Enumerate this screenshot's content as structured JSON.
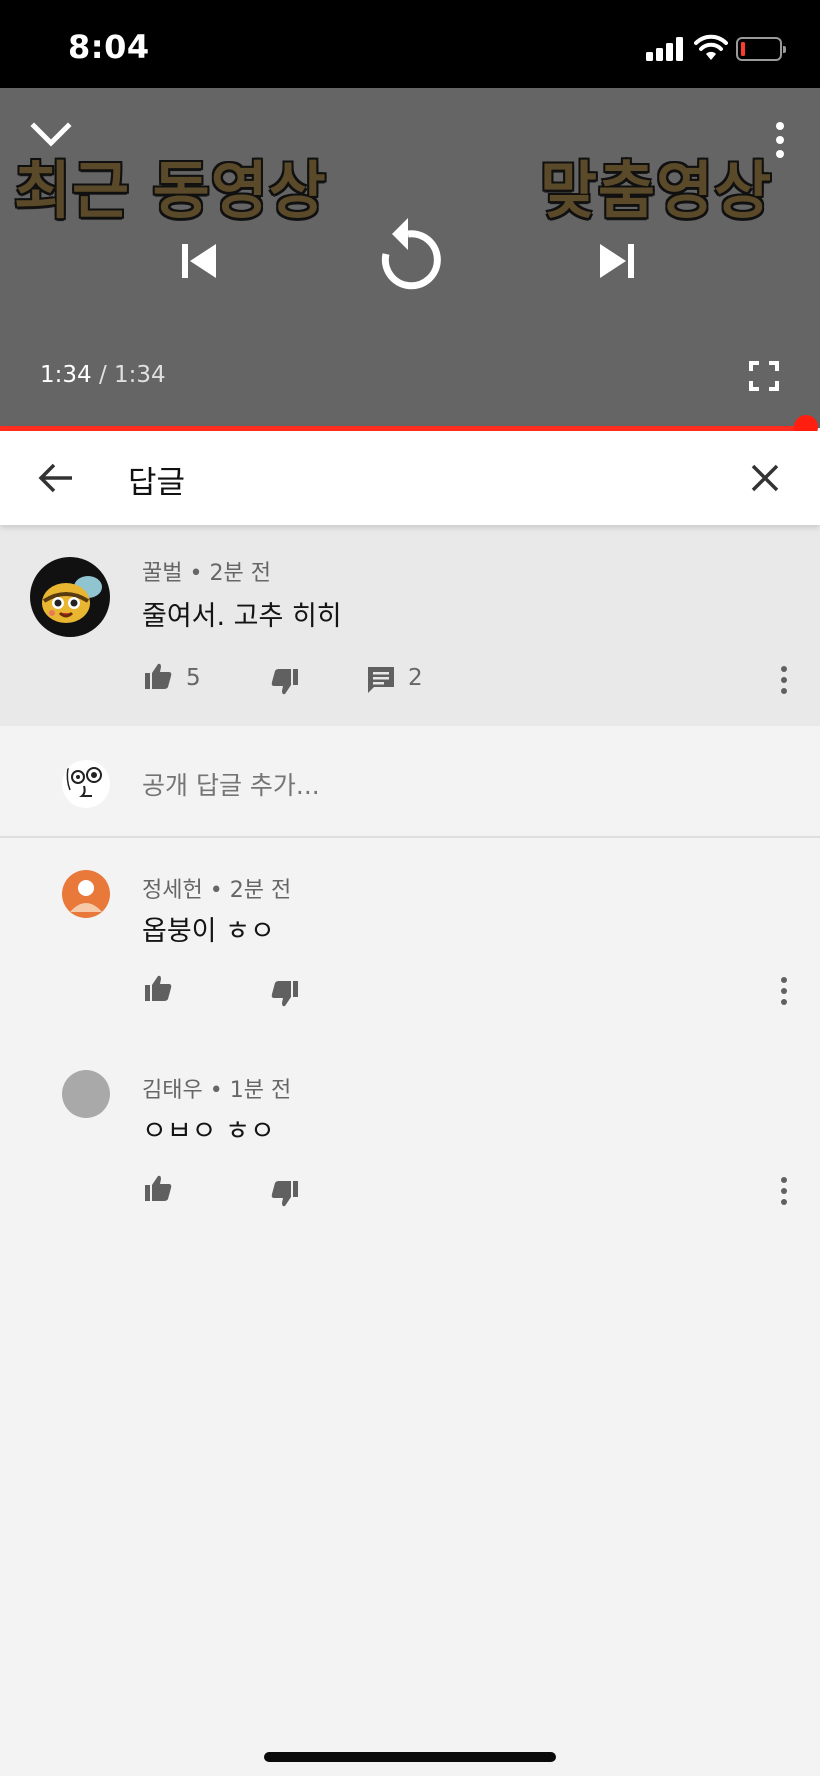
{
  "status_bar": {
    "time": "8:04"
  },
  "player": {
    "title_left": "최근 동영상",
    "title_right": "맞춤영상",
    "current_time": "1:34",
    "separator": "/",
    "duration": "1:34",
    "progress_fraction": 1.0,
    "accent_color": "#ff2d1f"
  },
  "replies_header": {
    "title": "답글"
  },
  "parent_comment": {
    "author": "꿀벌",
    "age": "2분 전",
    "text": "줄여서. 고추 히히",
    "likes": "5",
    "replies": "2"
  },
  "add_reply": {
    "placeholder": "공개 답글 추가..."
  },
  "replies": [
    {
      "author": "정세헌",
      "age": "2분 전",
      "text": "옵붕이 ㅎㅇ"
    },
    {
      "author": "김태우",
      "age": "1분 전",
      "text": "ㅇㅂㅇ ㅎㅇ"
    }
  ],
  "icons": {
    "dislike": "thumb-down-icon",
    "like": "thumb-up-icon",
    "reply": "comment-icon",
    "more": "more-vert-icon"
  }
}
